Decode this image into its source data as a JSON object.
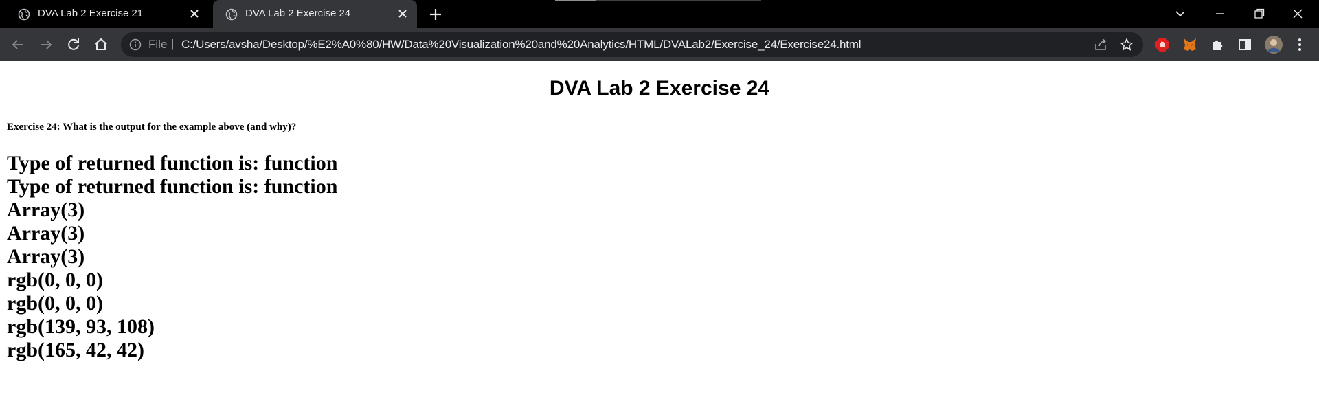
{
  "browser": {
    "tabs": [
      {
        "title": "DVA Lab 2 Exercise 21",
        "active": false
      },
      {
        "title": "DVA Lab 2 Exercise 24",
        "active": true
      }
    ],
    "address_bar": {
      "scheme_label": "File",
      "separator": "|",
      "url": "C:/Users/avsha/Desktop/%E2%A0%80/HW/Data%20Visualization%20and%20Analytics/HTML/DVALab2/Exercise_24/Exercise24.html"
    },
    "colors": {
      "tabstrip_bg": "#000000",
      "toolbar_bg": "#35363a",
      "omnibox_bg": "#202124",
      "text": "#e8eaed",
      "muted": "#9aa0a6"
    }
  },
  "page": {
    "heading": "DVA Lab 2 Exercise 24",
    "question": "Exercise 24: What is the output for the example above (and why)?",
    "output_lines": [
      "Type of returned function is: function",
      "Type of returned function is: function",
      "Array(3)",
      "Array(3)",
      "Array(3)",
      "rgb(0, 0, 0)",
      "rgb(0, 0, 0)",
      "rgb(139, 93, 108)",
      "rgb(165, 42, 42)"
    ]
  }
}
